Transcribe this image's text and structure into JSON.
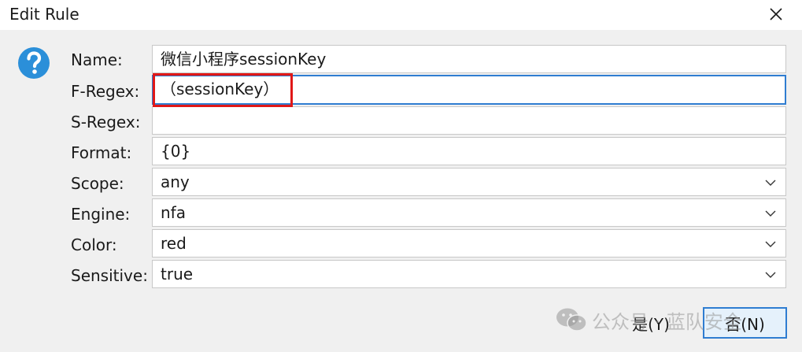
{
  "window": {
    "title": "Edit Rule",
    "close_icon": "close-icon"
  },
  "form": {
    "name": {
      "label": "Name:",
      "value": "微信小程序sessionKey"
    },
    "f_regex": {
      "label": "F-Regex:",
      "value": "（sessionKey）"
    },
    "s_regex": {
      "label": "S-Regex:",
      "value": ""
    },
    "format": {
      "label": "Format:",
      "value": "{0}"
    },
    "scope": {
      "label": "Scope:",
      "value": "any"
    },
    "engine": {
      "label": "Engine:",
      "value": "nfa"
    },
    "color": {
      "label": "Color:",
      "value": "red"
    },
    "sensitive": {
      "label": "Sensitive:",
      "value": "true"
    }
  },
  "buttons": {
    "yes": "是(Y)",
    "no": "否(N)"
  },
  "watermark": {
    "text": "公众号 · 蓝队安全",
    "icon": "wechat-icon"
  },
  "colors": {
    "focus_blue": "#2f7dd1",
    "annotation_red": "#e01818",
    "help_icon_blue": "#2b8fd9"
  }
}
